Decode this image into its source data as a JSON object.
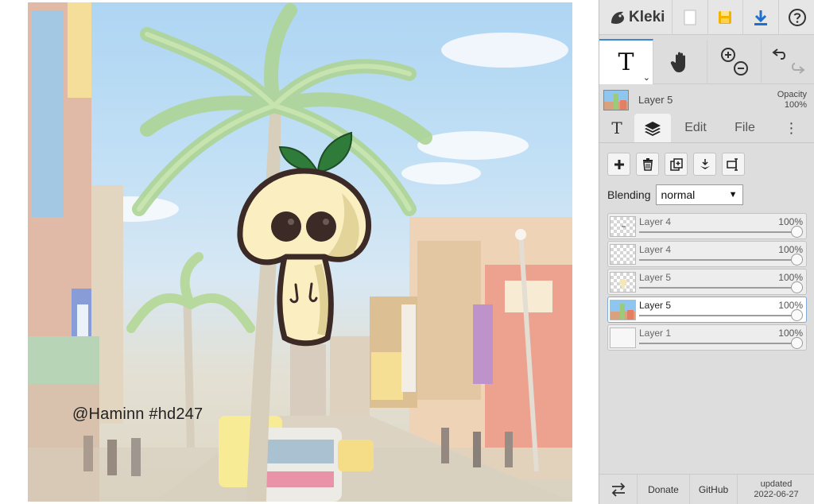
{
  "app": {
    "name": "Kleki"
  },
  "artwork": {
    "signature": "@Haminn #hd247"
  },
  "toolbar": {
    "text_tool_glyph": "T"
  },
  "layer_panel": {
    "current_layer_name": "Layer 5",
    "opacity_label": "Opacity",
    "opacity_value": "100%",
    "tabs": {
      "text": "T",
      "edit": "Edit",
      "file": "File",
      "more": "⋮"
    },
    "blending_label": "Blending",
    "blending_value": "normal",
    "layers": [
      {
        "name": "Layer 4",
        "opacity": "100%",
        "selected": false
      },
      {
        "name": "Layer 4",
        "opacity": "100%",
        "selected": false
      },
      {
        "name": "Layer 5",
        "opacity": "100%",
        "selected": false
      },
      {
        "name": "Layer 5",
        "opacity": "100%",
        "selected": true
      },
      {
        "name": "Layer 1",
        "opacity": "100%",
        "selected": false
      }
    ]
  },
  "footer": {
    "donate": "Donate",
    "github": "GitHub",
    "updated_label": "updated",
    "updated_date": "2022-06-27"
  },
  "colors": {
    "accent": "#3b86d6",
    "save_icon": "#f2b300",
    "download_icon": "#1e6fd0"
  }
}
